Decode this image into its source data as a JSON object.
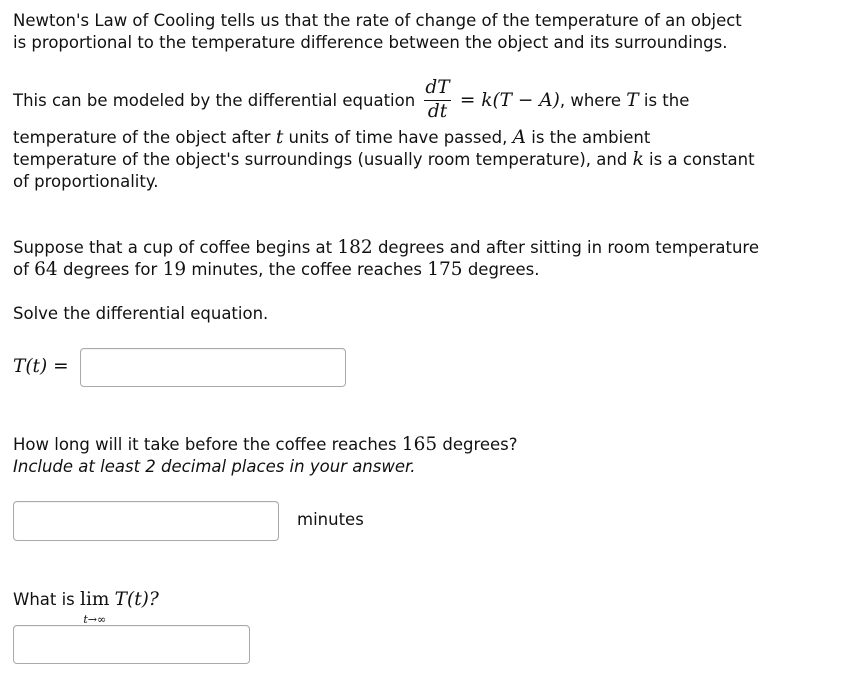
{
  "intro": {
    "line1": "Newton's Law of Cooling tells us that the rate of change of the temperature of an object",
    "line2": "is proportional to the temperature difference between the object and its surroundings."
  },
  "model": {
    "prefix": "This can be modeled by the differential equation",
    "frac_num": "dT",
    "frac_den": "dt",
    "rhs": "= k(T − A)",
    "where": ", where",
    "T_sym": "T",
    "is_the": "is the",
    "line2_a": "temperature of the object after",
    "t_sym": "t",
    "line2_b": "units of time have passed,",
    "A_sym": "A",
    "line2_c": "is the ambient",
    "line3_a": "temperature of the object's surroundings (usually room temperature), and",
    "k_sym": "k",
    "line3_b": "is a constant",
    "line4": "of proportionality."
  },
  "scenario": {
    "s1": "Suppose that a cup of coffee begins at",
    "v1": "182",
    "s2": "degrees and after sitting in room temperature",
    "s3": "of",
    "v2": "64",
    "s4": "degrees for",
    "v3": "19",
    "s5": "minutes, the coffee reaches",
    "v4": "175",
    "s6": "degrees."
  },
  "part1": {
    "prompt": "Solve the differential equation.",
    "label": "T(t) =",
    "answer": ""
  },
  "part2": {
    "q1": "How long will it take before the coffee reaches",
    "v": "165",
    "q2": "degrees?",
    "note": "Include at least 2 decimal places in your answer.",
    "answer": "",
    "unit": "minutes"
  },
  "part3": {
    "q": "What is",
    "lim": "lim",
    "lim_sub": "t→∞",
    "func": "T(t)?",
    "answer": ""
  }
}
